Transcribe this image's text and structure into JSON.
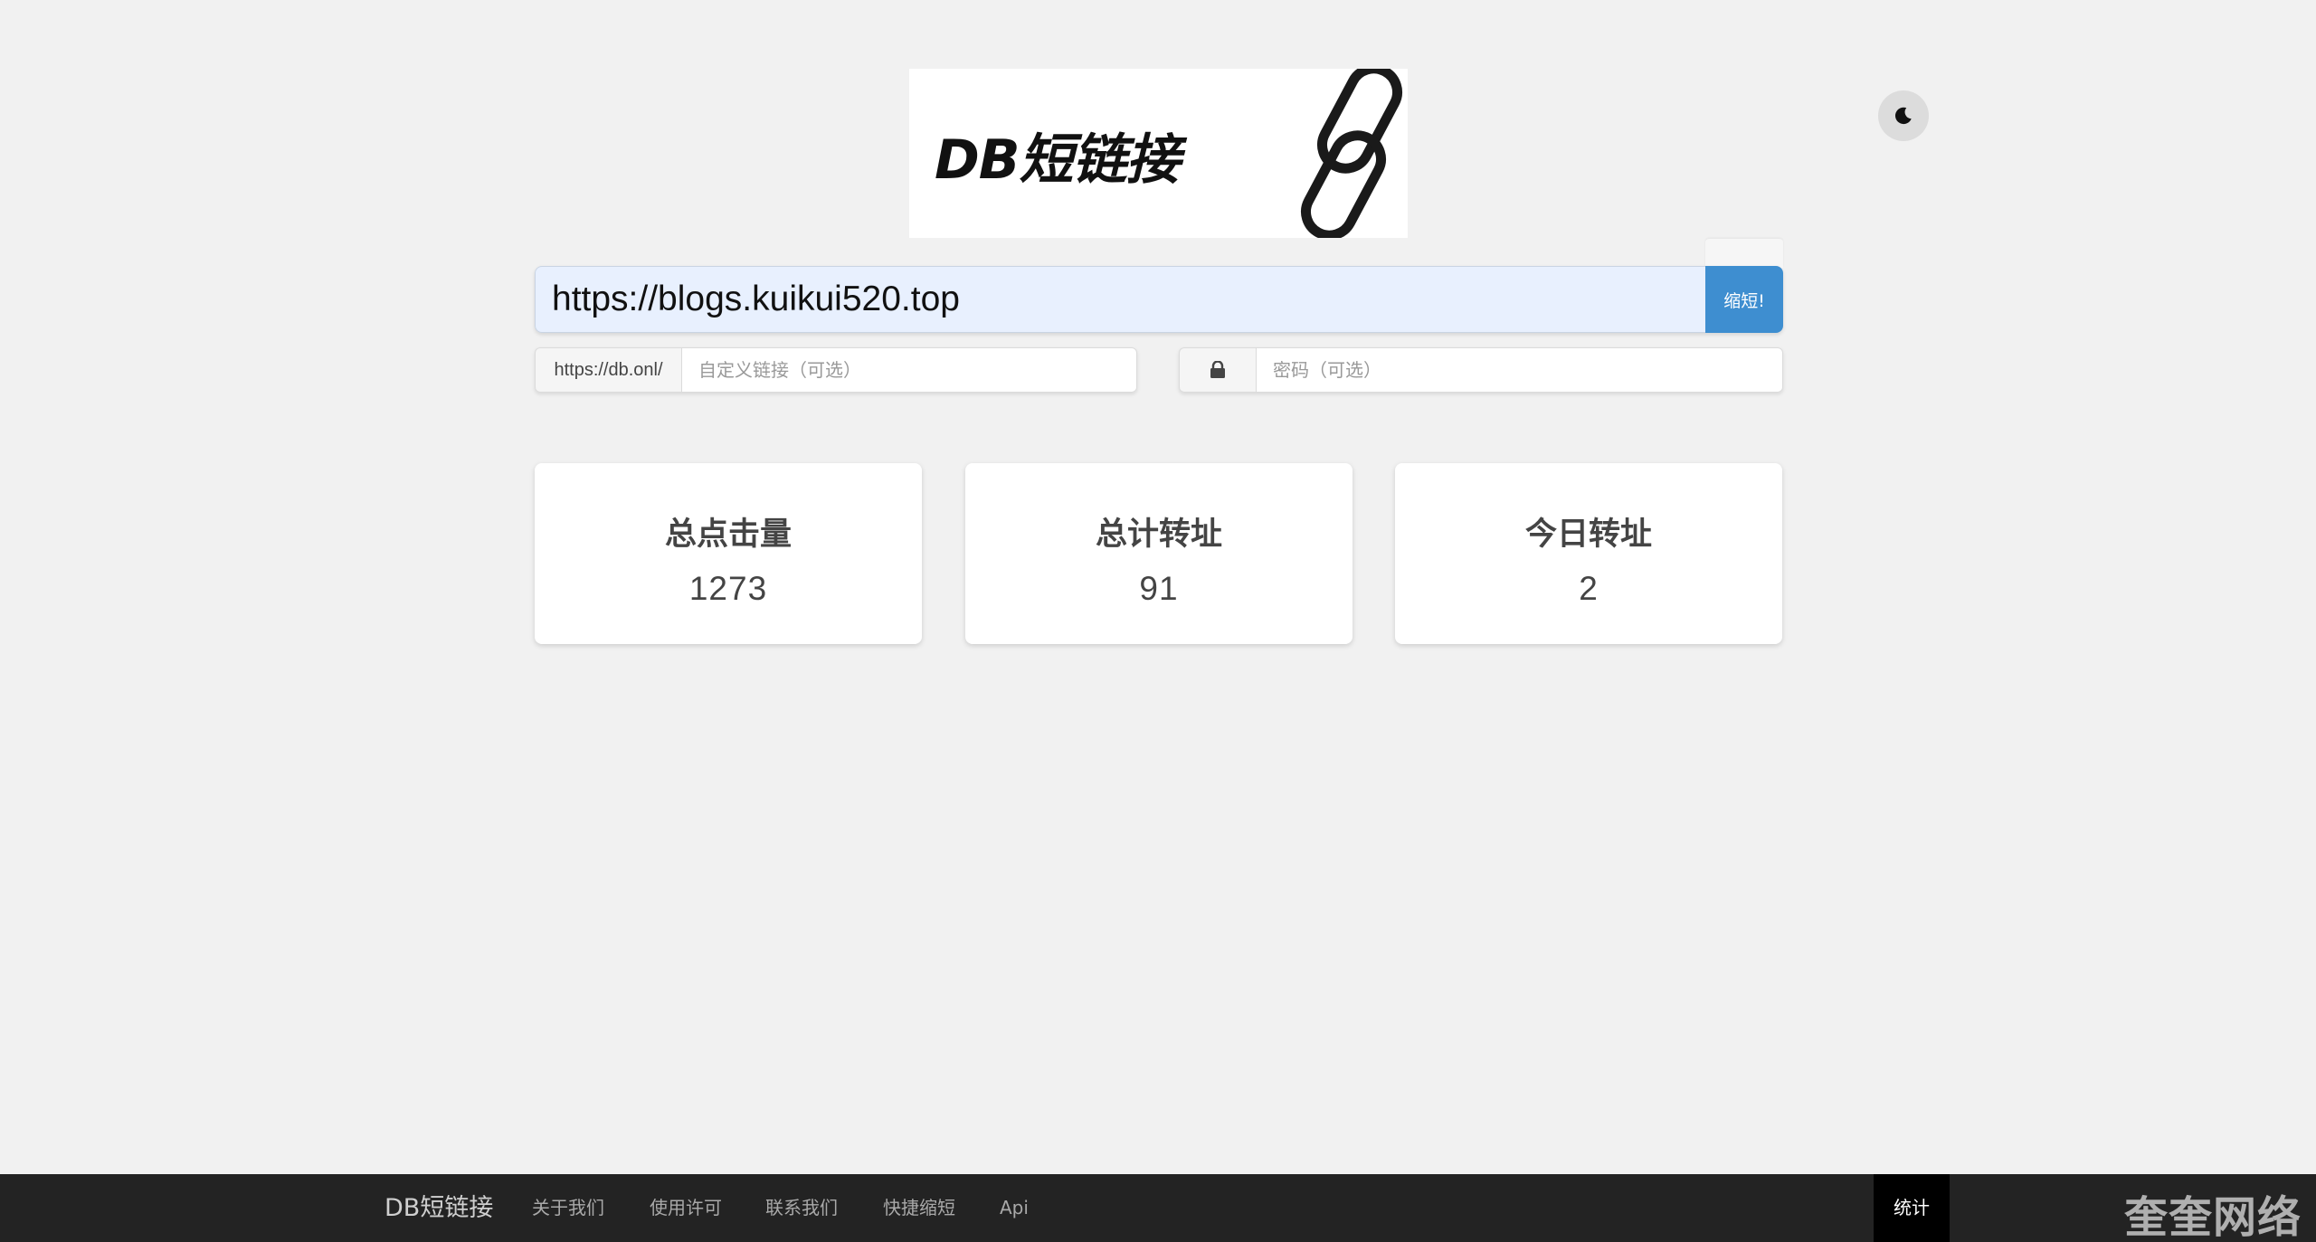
{
  "logo": {
    "text": "DB短链接"
  },
  "theme_toggle": {
    "icon": "moon-icon"
  },
  "shorten_form": {
    "url_value": "https://blogs.kuikui520.top",
    "submit_label": "缩短!",
    "custom_prefix": "https://db.onl/",
    "custom_placeholder": "自定义链接（可选）",
    "password_icon": "lock-icon",
    "password_placeholder": "密码（可选）"
  },
  "stats": [
    {
      "title": "总点击量",
      "value": "1273"
    },
    {
      "title": "总计转址",
      "value": "91"
    },
    {
      "title": "今日转址",
      "value": "2"
    }
  ],
  "footer": {
    "brand": "DB短链接",
    "links": [
      "关于我们",
      "使用许可",
      "联系我们",
      "快捷缩短",
      "Api"
    ],
    "stats_button": "统计"
  },
  "watermark": "奎奎网络",
  "colors": {
    "accent": "#3e8ed0",
    "background": "#f1f1f1",
    "footer": "#232323"
  }
}
